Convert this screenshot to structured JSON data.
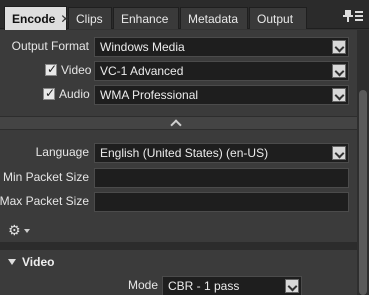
{
  "tabs": [
    {
      "label": "Encode",
      "close": "✕",
      "active": true
    },
    {
      "label": "Clips"
    },
    {
      "label": "Enhance"
    },
    {
      "label": "Metadata"
    },
    {
      "label": "Output"
    }
  ],
  "form": {
    "output_format": {
      "label": "Output Format",
      "value": "Windows Media"
    },
    "video": {
      "label": "Video",
      "checked": true,
      "value": "VC-1 Advanced"
    },
    "audio": {
      "label": "Audio",
      "checked": true,
      "value": "WMA Professional"
    },
    "language": {
      "label": "Language",
      "value": "English (United States) (en-US)"
    },
    "min_packet": {
      "label": "Min Packet Size",
      "value": ""
    },
    "max_packet": {
      "label": "Max Packet Size",
      "value": ""
    }
  },
  "video_section": {
    "title": "Video",
    "mode": {
      "label": "Mode",
      "value": "CBR - 1 pass"
    }
  },
  "icons": {
    "gear": "⚙",
    "pin": "▪"
  }
}
